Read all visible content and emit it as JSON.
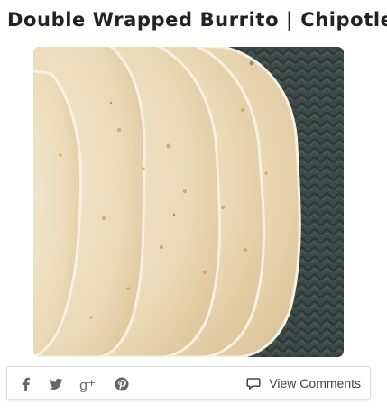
{
  "article": {
    "title": "Double Wrapped Burrito | Chipotle",
    "image": {
      "subject": "stack-of-flour-tortillas",
      "background_color": "#3d4c48",
      "tortilla_color": "#eee1c3"
    }
  },
  "share_bar": {
    "icons": [
      "facebook-icon",
      "twitter-icon",
      "google-plus-icon",
      "pinterest-icon"
    ],
    "icon_color": "#666666",
    "comments_label": "View Comments",
    "comments_icon": "speech-bubble-icon"
  }
}
